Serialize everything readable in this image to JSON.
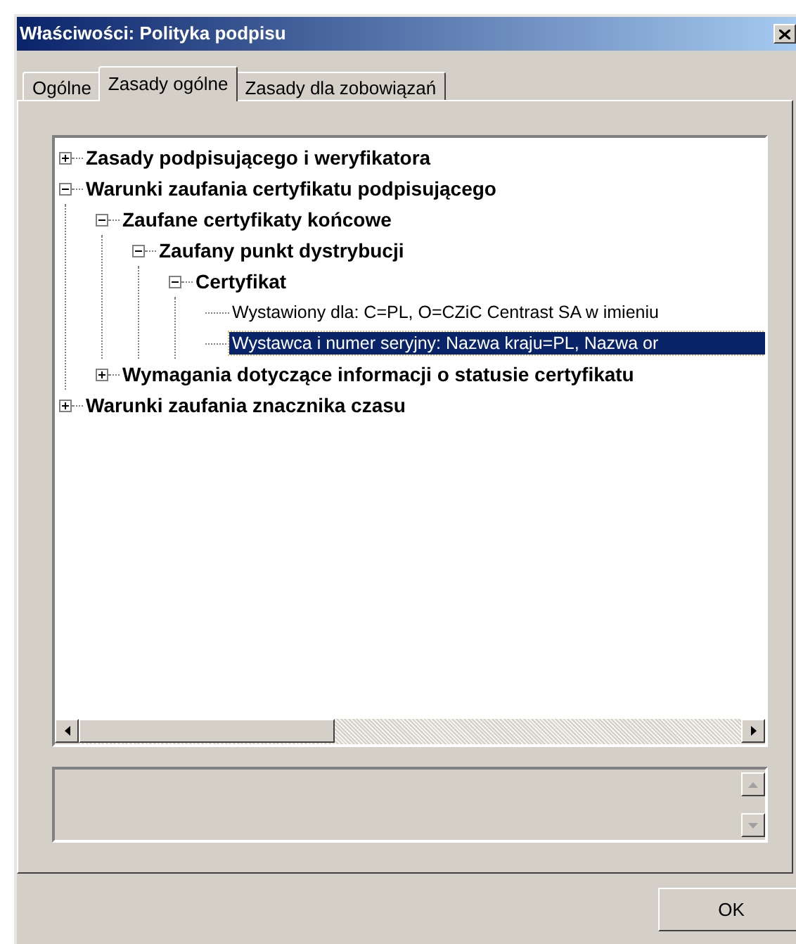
{
  "window": {
    "title": "Właściwości: Polityka podpisu"
  },
  "tabs": [
    {
      "label": "Ogólne",
      "selected": false
    },
    {
      "label": "Zasady ogólne",
      "selected": true
    },
    {
      "label": "Zasady dla zobowiązań",
      "selected": false
    }
  ],
  "tree": [
    {
      "kind": "node",
      "label": "Zasady podpisującego i weryfikatora",
      "expanded": false,
      "selected": false
    },
    {
      "kind": "node",
      "label": "Warunki zaufania certyfikatu podpisującego",
      "expanded": true,
      "selected": false,
      "children": [
        {
          "kind": "node",
          "label": "Zaufane certyfikaty końcowe",
          "expanded": true,
          "selected": false,
          "children": [
            {
              "kind": "node",
              "label": "Zaufany punkt dystrybucji",
              "expanded": true,
              "selected": false,
              "children": [
                {
                  "kind": "node",
                  "label": "Certyfikat",
                  "expanded": true,
                  "selected": false,
                  "children": [
                    {
                      "kind": "leaf",
                      "label": "Wystawiony dla: C=PL, O=CZiC Centrast SA w imieniu",
                      "selected": false
                    },
                    {
                      "kind": "leaf",
                      "label": "Wystawca i numer seryjny: Nazwa kraju=PL, Nazwa or",
                      "selected": true
                    }
                  ]
                }
              ]
            }
          ]
        },
        {
          "kind": "node",
          "label": "Wymagania dotyczące informacji o statusie certyfikatu",
          "expanded": false,
          "selected": false
        }
      ]
    },
    {
      "kind": "node",
      "label": "Warunki zaufania znacznika czasu",
      "expanded": false,
      "selected": false
    }
  ],
  "buttons": [
    "OK"
  ]
}
